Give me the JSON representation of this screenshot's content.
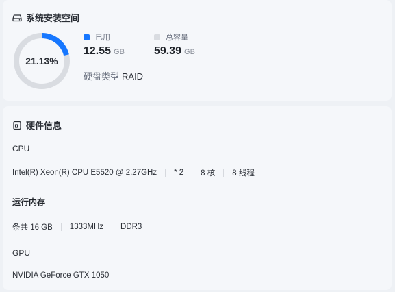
{
  "storage": {
    "title": "系统安装空间",
    "icon": "hard-drive-icon",
    "percent_label": "21.13%",
    "used_fraction": 0.2113,
    "used": {
      "label": "已用",
      "value": "12.55",
      "unit": "GB",
      "color": "#1677ff"
    },
    "total": {
      "label": "总容量",
      "value": "59.39",
      "unit": "GB",
      "color": "#d9dce1"
    },
    "disk_type": {
      "label": "硬盘类型",
      "value": "RAID"
    }
  },
  "hardware": {
    "title": "硬件信息",
    "icon": "device-icon",
    "cpu": {
      "title": "CPU",
      "model": "Intel(R) Xeon(R) CPU E5520 @ 2.27GHz",
      "count": "* 2",
      "cores": "8 核",
      "threads": "8 线程"
    },
    "memory": {
      "title": "运行内存",
      "total": "条共 16 GB",
      "speed": "1333MHz",
      "type": "DDR3"
    },
    "gpu": {
      "title": "GPU",
      "model": "NVIDIA GeForce GTX 1050"
    }
  }
}
